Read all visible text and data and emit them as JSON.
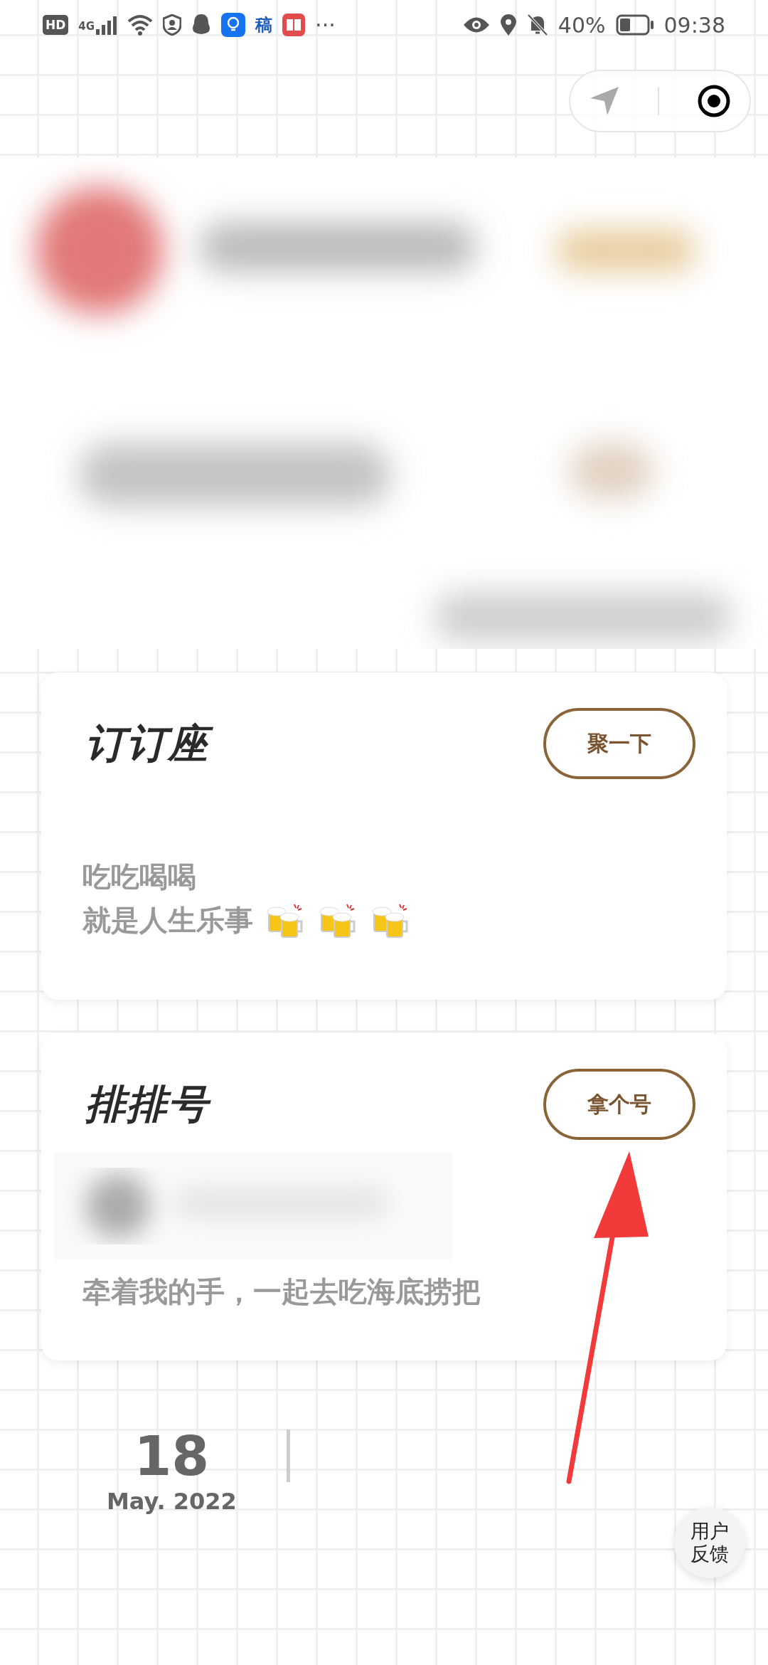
{
  "status_bar": {
    "hd": "HD",
    "network": "4G",
    "app_badge": "稿",
    "more": "···",
    "battery": "40%",
    "time": "09:38"
  },
  "cards": [
    {
      "kind": "text",
      "title": "订订座",
      "button": "聚一下",
      "lines": [
        "吃吃喝喝",
        "就是人生乐事"
      ]
    },
    {
      "kind": "queue",
      "title": "排排号",
      "button": "拿个号",
      "lines": [
        "牵着我的手，一起去吃海底捞把"
      ]
    }
  ],
  "date": {
    "day": "18",
    "month_year": "May. 2022"
  },
  "feedback": "用户反馈"
}
